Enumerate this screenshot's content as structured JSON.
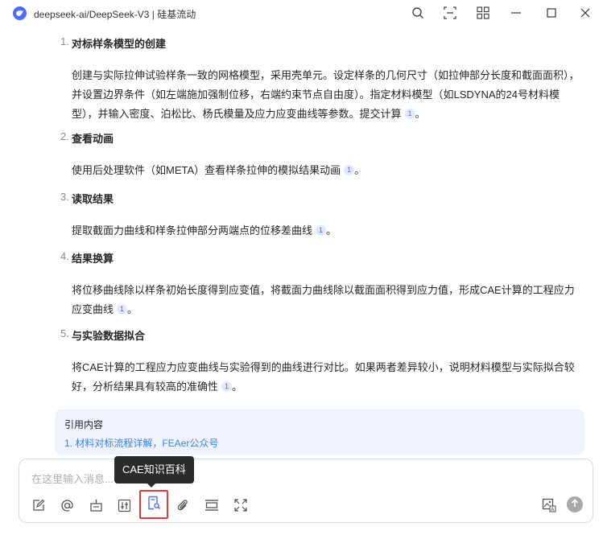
{
  "window": {
    "title": "deepseek-ai/DeepSeek-V3 | 硅基流动"
  },
  "titlebar_icons": [
    "search-icon",
    "scan-icon",
    "grid-icon",
    "minimize-icon",
    "maximize-icon",
    "close-icon"
  ],
  "sections": [
    {
      "num": "1.",
      "title": "对标样条模型的创建",
      "body": "创建与实际拉伸试验样条一致的网格模型，采用壳单元。设定样条的几何尺寸（如拉伸部分长度和截面面积），并设置边界条件（如左端施加强制位移，右端约束节点自由度）。指定材料模型（如LSDYNA的24号材料模型），并输入密度、泊松比、杨氏模量及应力应变曲线等参数。提交计算",
      "cite": "1",
      "end": "。"
    },
    {
      "num": "2.",
      "title": "查看动画",
      "body": "使用后处理软件（如META）查看样条拉伸的模拟结果动画",
      "cite": "1",
      "end": "。"
    },
    {
      "num": "3.",
      "title": "读取结果",
      "body": "提取截面力曲线和样条拉伸部分两端点的位移差曲线",
      "cite": "1",
      "end": "。"
    },
    {
      "num": "4.",
      "title": "结果换算",
      "body": "将位移曲线除以样条初始长度得到应变值，将截面力曲线除以截面面积得到应力值，形成CAE计算的工程应力应变曲线",
      "cite": "1",
      "end": "。"
    },
    {
      "num": "5.",
      "title": "与实验数据拟合",
      "body": "将CAE计算的工程应力应变曲线与实验得到的曲线进行对比。如果两者差异较小，说明材料模型与实际拟合较好，分析结果具有较高的准确性",
      "cite": "1",
      "end": "。"
    }
  ],
  "references": {
    "title": "引用内容",
    "items": [
      "1. 材料对标流程详解，FEAer公众号"
    ]
  },
  "input": {
    "placeholder": "在这里输入消息..."
  },
  "tooltip": {
    "text": "CAE知识百科"
  },
  "toolbar": [
    "edit-icon",
    "at-icon",
    "robot-icon",
    "sliders-icon",
    "knowledge-base-icon",
    "attachment-icon",
    "layout-icon",
    "expand-icon",
    "image-text-icon",
    "send-icon"
  ],
  "colors": {
    "accent": "#4d6bfe",
    "link": "#3b82f6",
    "ref_bg": "#eef3fb",
    "highlight_border": "#e53935"
  }
}
